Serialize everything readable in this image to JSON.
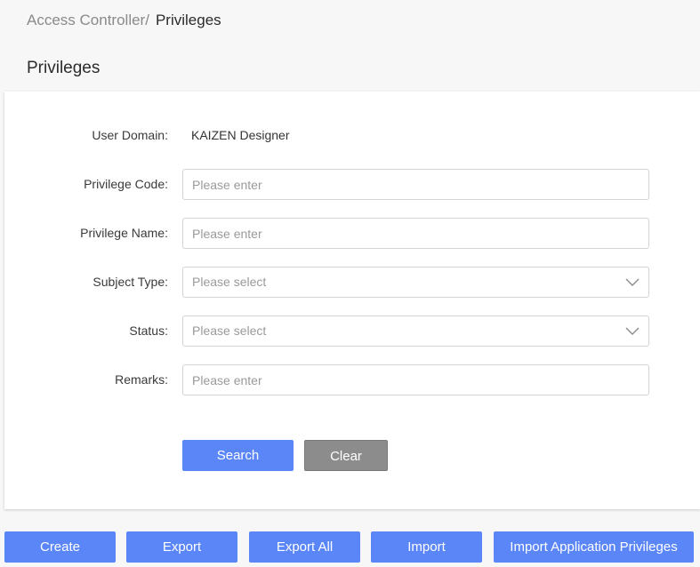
{
  "breadcrumb": {
    "parent": "Access Controller",
    "separator": "/",
    "current": "Privileges"
  },
  "page": {
    "title": "Privileges"
  },
  "form": {
    "user_domain": {
      "label": "User Domain:",
      "value": "KAIZEN Designer"
    },
    "privilege_code": {
      "label": "Privilege Code:",
      "placeholder": "Please enter",
      "value": ""
    },
    "privilege_name": {
      "label": "Privilege Name:",
      "placeholder": "Please enter",
      "value": ""
    },
    "subject_type": {
      "label": "Subject Type:",
      "placeholder": "Please select"
    },
    "status": {
      "label": "Status:",
      "placeholder": "Please select"
    },
    "remarks": {
      "label": "Remarks:",
      "placeholder": "Please enter",
      "value": ""
    },
    "search_label": "Search",
    "clear_label": "Clear"
  },
  "actions": {
    "create_label": "Create",
    "export_label": "Export",
    "export_all_label": "Export All",
    "import_label": "Import",
    "import_app_label": "Import Application Privileges"
  },
  "icons": {
    "select_arrow": "chevron-down-icon"
  },
  "colors": {
    "primary": "#5b86f7",
    "secondary": "#8c8c8c",
    "background": "#f7f7f7",
    "panel": "#ffffff"
  }
}
